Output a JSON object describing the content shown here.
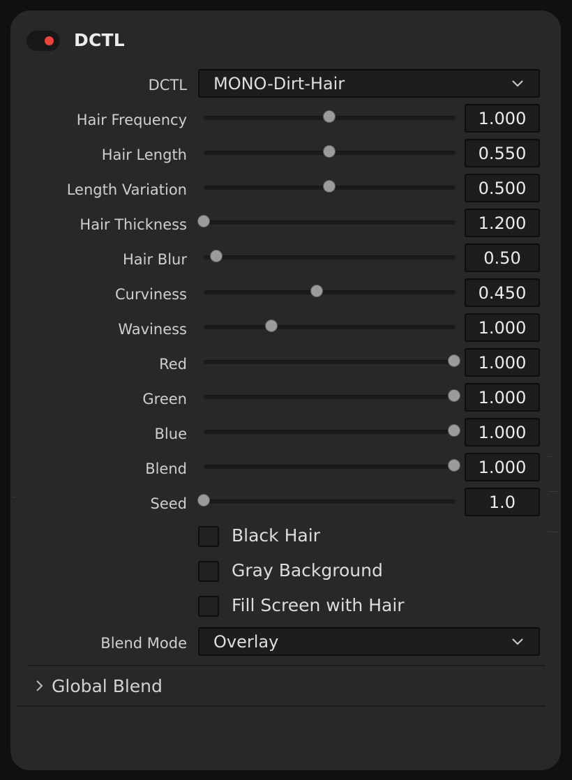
{
  "header": {
    "title": "DCTL",
    "enabled": true,
    "toggle_color": "#e8453c"
  },
  "dctl_select": {
    "label": "DCTL",
    "value": "MONO-Dirt-Hair"
  },
  "sliders": [
    {
      "label": "Hair Frequency",
      "value": "1.000",
      "position": 0.5
    },
    {
      "label": "Hair Length",
      "value": "0.550",
      "position": 0.5
    },
    {
      "label": "Length Variation",
      "value": "0.500",
      "position": 0.5
    },
    {
      "label": "Hair Thickness",
      "value": "1.200",
      "position": 0.0
    },
    {
      "label": "Hair Blur",
      "value": "0.50",
      "position": 0.05
    },
    {
      "label": "Curviness",
      "value": "0.450",
      "position": 0.45
    },
    {
      "label": "Waviness",
      "value": "1.000",
      "position": 0.27
    },
    {
      "label": "Red",
      "value": "1.000",
      "position": 1.0
    },
    {
      "label": "Green",
      "value": "1.000",
      "position": 1.0
    },
    {
      "label": "Blue",
      "value": "1.000",
      "position": 1.0
    },
    {
      "label": "Blend",
      "value": "1.000",
      "position": 1.0
    },
    {
      "label": "Seed",
      "value": "1.0",
      "position": 0.0
    }
  ],
  "checkboxes": [
    {
      "label": "Black Hair",
      "checked": false
    },
    {
      "label": "Gray Background",
      "checked": false
    },
    {
      "label": "Fill Screen with Hair",
      "checked": false
    }
  ],
  "blend_mode": {
    "label": "Blend Mode",
    "value": "Overlay"
  },
  "global_blend": {
    "label": "Global Blend",
    "expanded": false
  }
}
